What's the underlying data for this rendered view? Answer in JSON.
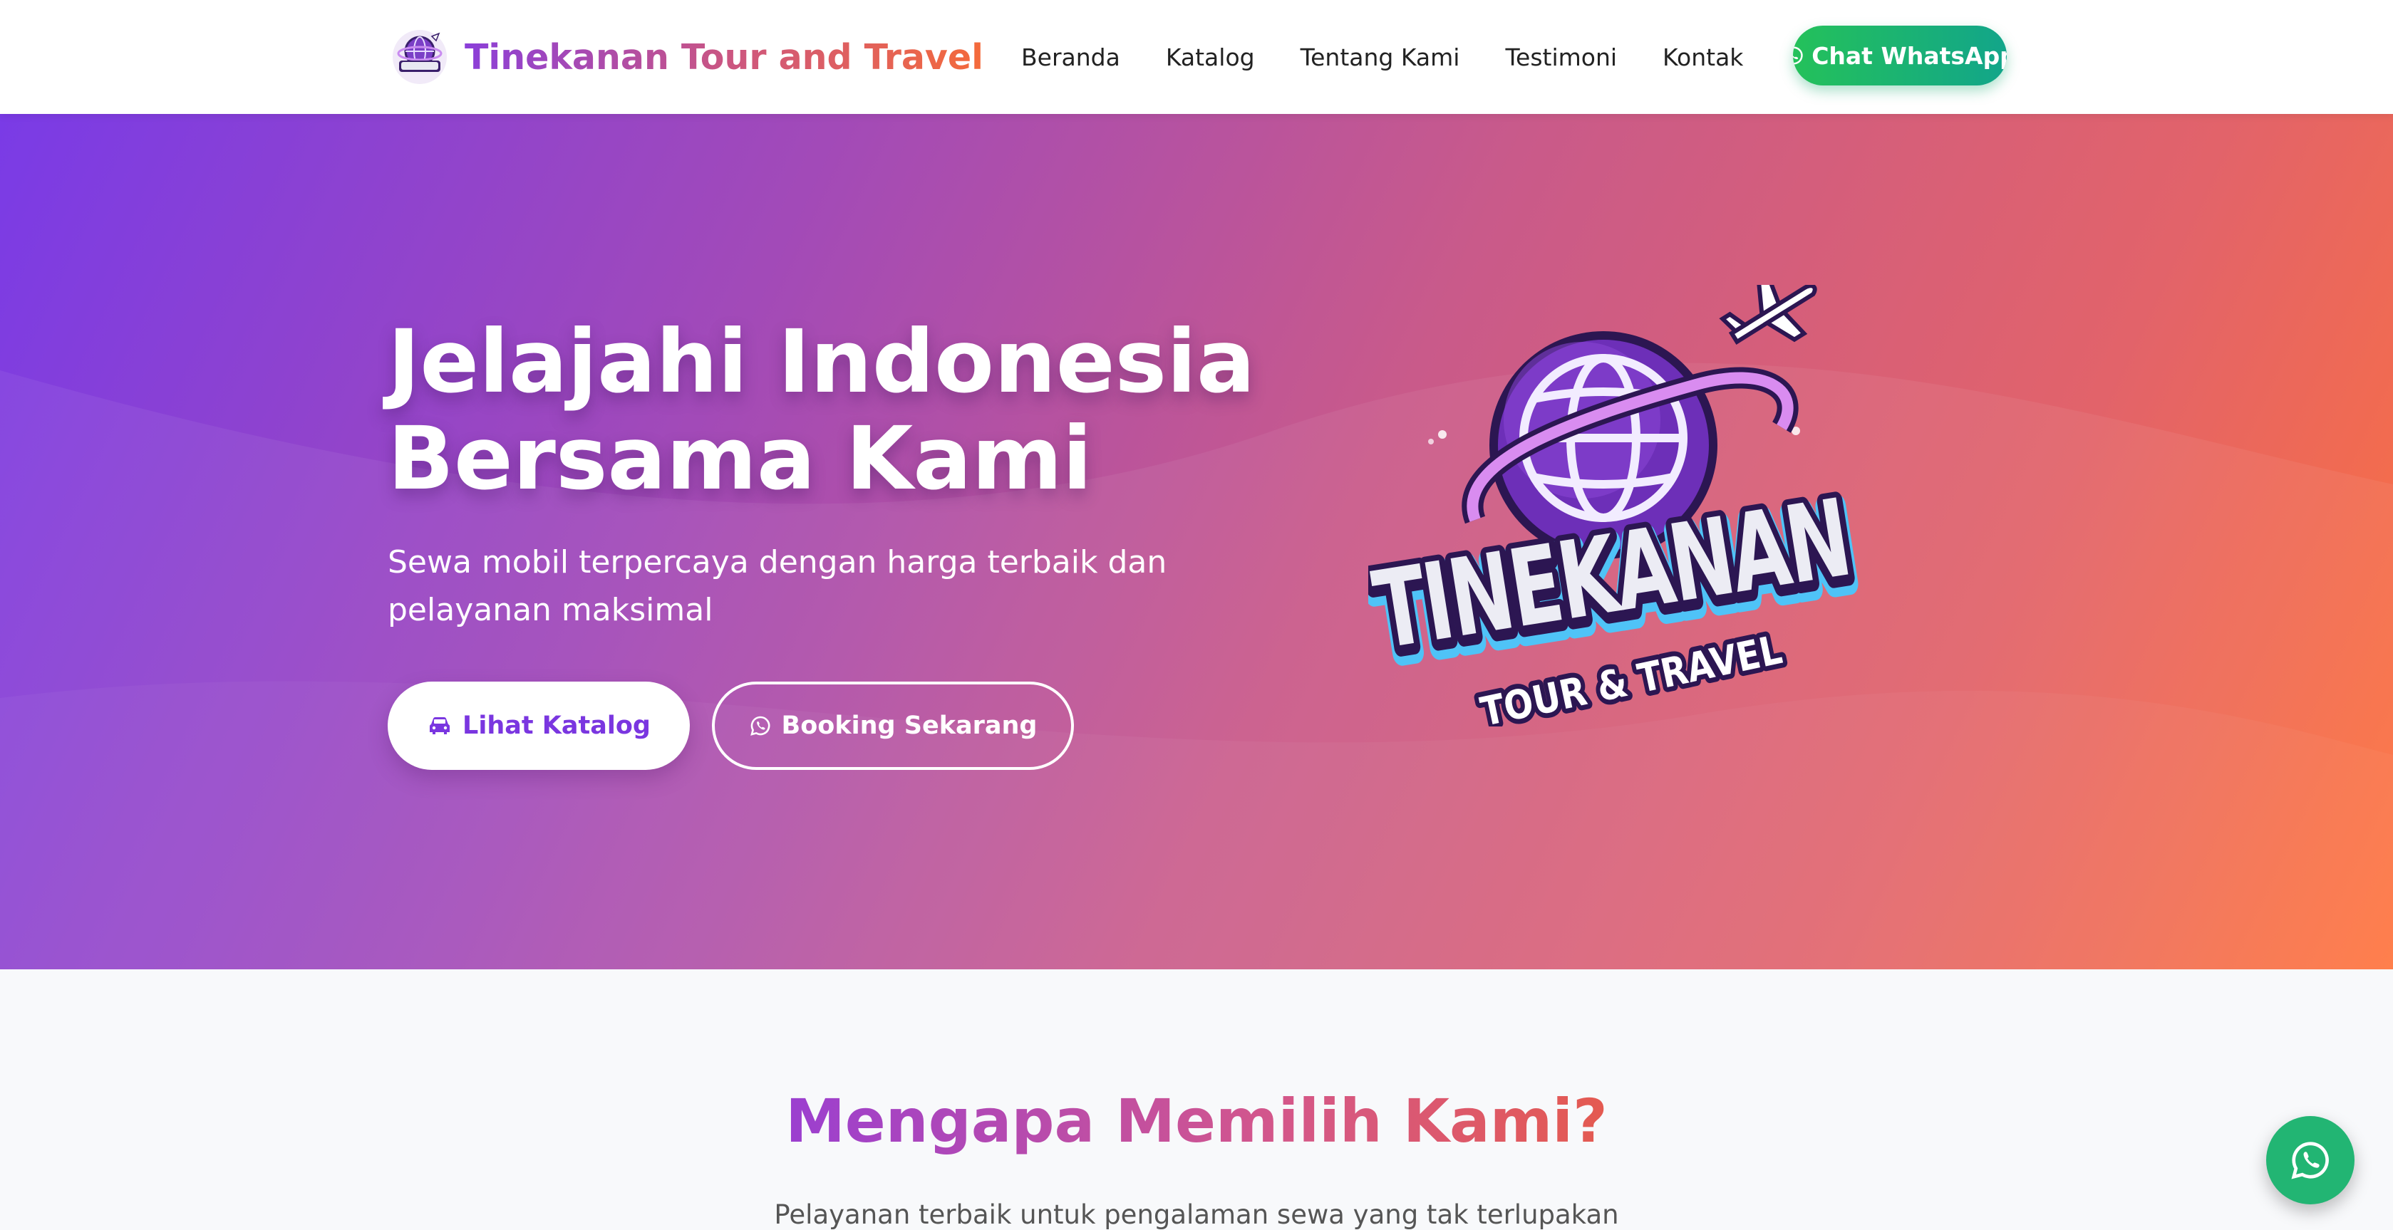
{
  "navbar": {
    "brand_name": "Tinekanan Tour and Travel",
    "links": [
      "Beranda",
      "Katalog",
      "Tentang Kami",
      "Testimoni",
      "Kontak"
    ],
    "cta_label": "Chat WhatsApp",
    "logo_icon": "tinekanan-logo-icon"
  },
  "hero": {
    "title_line1": "Jelajahi Indonesia",
    "title_line2": "Bersama Kami",
    "subtitle": "Sewa mobil terpercaya dengan harga terbaik dan pelayanan maksimal",
    "primary_button": "Lihat Katalog",
    "secondary_button": "Booking Sekarang",
    "logo_text_main": "TINEKANAN",
    "logo_text_sub": "TOUR & TRAVEL"
  },
  "why_section": {
    "title": "Mengapa Memilih Kami?",
    "subtitle": "Pelayanan terbaik untuk pengalaman sewa yang tak terlupakan"
  },
  "floating": {
    "icon": "whatsapp-icon"
  },
  "colors": {
    "primary_purple": "#7a36e0",
    "accent_orange": "#ff723a",
    "whatsapp_green": "#22b573"
  }
}
